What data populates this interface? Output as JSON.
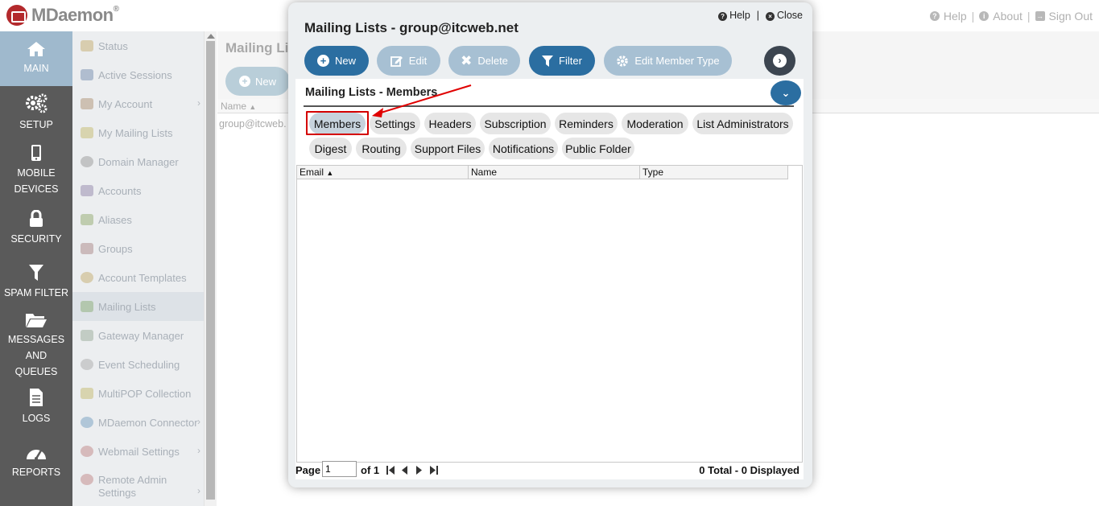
{
  "app": {
    "brand": "MDaemon",
    "brand_mark": "®",
    "top_links": [
      {
        "label": "Help",
        "icon": "question-icon"
      },
      {
        "label": "About",
        "icon": "info-icon"
      },
      {
        "label": "Sign Out",
        "icon": "signout-icon"
      }
    ]
  },
  "leftnav": {
    "items": [
      {
        "label": "MAIN",
        "icon": "home-icon"
      },
      {
        "label": "SETUP",
        "icon": "gears-icon"
      },
      {
        "label": "MOBILE DEVICES",
        "icon": "mobile-icon"
      },
      {
        "label": "SECURITY",
        "icon": "lock-icon"
      },
      {
        "label": "SPAM FILTER",
        "icon": "filter-icon"
      },
      {
        "label": "MESSAGES AND QUEUES",
        "icon": "folder-icon"
      },
      {
        "label": "LOGS",
        "icon": "document-icon"
      },
      {
        "label": "REPORTS",
        "icon": "gauge-icon"
      }
    ]
  },
  "subnav": {
    "items": [
      {
        "label": "Status",
        "chevron": false
      },
      {
        "label": "Active Sessions",
        "chevron": false
      },
      {
        "label": "My Account",
        "chevron": true
      },
      {
        "label": "My Mailing Lists",
        "chevron": false
      },
      {
        "label": "Domain Manager",
        "chevron": false
      },
      {
        "label": "Accounts",
        "chevron": false
      },
      {
        "label": "Aliases",
        "chevron": false
      },
      {
        "label": "Groups",
        "chevron": false
      },
      {
        "label": "Account Templates",
        "chevron": false
      },
      {
        "label": "Mailing Lists",
        "chevron": false
      },
      {
        "label": "Gateway Manager",
        "chevron": false
      },
      {
        "label": "Event Scheduling",
        "chevron": false
      },
      {
        "label": "MultiPOP Collection",
        "chevron": false
      },
      {
        "label": "MDaemon Connector",
        "chevron": true
      },
      {
        "label": "Webmail Settings",
        "chevron": true
      },
      {
        "label": "Remote Admin Settings",
        "chevron": true
      }
    ]
  },
  "background": {
    "title": "Mailing Lis",
    "new_label": "New",
    "column_name": "Name",
    "row_text": "group@itcweb."
  },
  "modal": {
    "title": "Mailing Lists - group@itcweb.net",
    "help_label": "Help",
    "close_label": "Close",
    "toolbar": {
      "new": "New",
      "edit": "Edit",
      "delete": "Delete",
      "filter": "Filter",
      "edit_member_type": "Edit Member Type"
    },
    "panel_title": "Mailing Lists - Members",
    "tabs_row1": [
      "Members",
      "Settings",
      "Headers",
      "Subscription",
      "Reminders",
      "Moderation",
      "List Administrators"
    ],
    "tabs_row2": [
      "Digest",
      "Routing",
      "Support Files",
      "Notifications",
      "Public Folder"
    ],
    "grid": {
      "columns": [
        "Email",
        "Name",
        "Type"
      ]
    },
    "footer": {
      "page_label": "Page",
      "page_value": "1",
      "of_label": "of 1",
      "total": "0 Total - 0 Displayed"
    }
  },
  "colors": {
    "primary": "#2b6ea1",
    "disabled": "#a7c0d3",
    "nav_bg": "#5a5a5a",
    "nav_active": "#9fb9cd",
    "highlight": "#d40000"
  }
}
